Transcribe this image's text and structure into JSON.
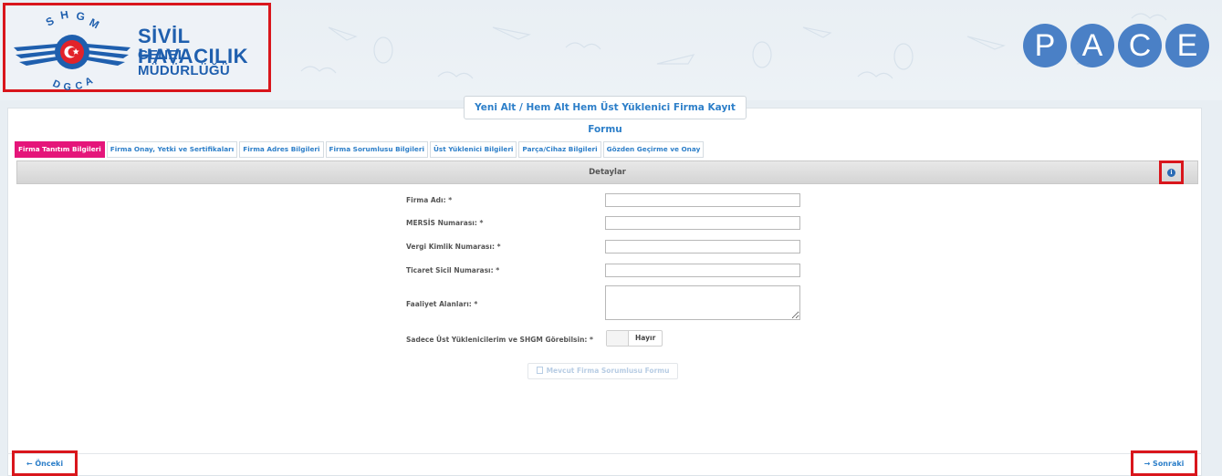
{
  "header": {
    "logo": {
      "arc_top_letters": "SHGM",
      "arc_bottom_letters": "DGCA",
      "title": "SİVİL HAVACILIK",
      "subtitle": "GENEL MÜDÜRLÜĞÜ"
    },
    "pace_letters": [
      "P",
      "A",
      "C",
      "E"
    ]
  },
  "form": {
    "title": "Yeni Alt / Hem Alt Hem Üst Yüklenici Firma Kayıt Formu",
    "tabs": [
      {
        "label": "Firma Tanıtım Bilgileri",
        "active": true
      },
      {
        "label": "Firma Onay, Yetki ve Sertifikaları"
      },
      {
        "label": "Firma Adres Bilgileri"
      },
      {
        "label": "Firma Sorumlusu Bilgileri"
      },
      {
        "label": "Üst Yüklenici Bilgileri"
      },
      {
        "label": "Parça/Cihaz Bilgileri"
      },
      {
        "label": "Gözden Geçirme ve Onay"
      }
    ],
    "section_title": "Detaylar",
    "fields": [
      {
        "label": "Firma Adı: *",
        "value": ""
      },
      {
        "label": "MERSİS Numarası: *",
        "value": ""
      },
      {
        "label": "Vergi Kimlik Numarası: *",
        "value": ""
      },
      {
        "label": "Ticaret Sicil Numarası: *",
        "value": ""
      },
      {
        "label": "Faaliyet Alanları: *",
        "value": ""
      }
    ],
    "visibility_label": "Sadece Üst Yüklenicilerim ve SHGM Görebilsin: *",
    "visibility_value": "Hayır",
    "existing_manager_button": "Mevcut Firma Sorumlusu Formu"
  },
  "nav": {
    "prev": "← Önceki",
    "next": "→ Sonraki"
  },
  "colors": {
    "accent": "#2d7fc9",
    "active_tab": "#e5157a",
    "highlight_border": "#d9161c",
    "pace_blue": "#4a80c6"
  }
}
